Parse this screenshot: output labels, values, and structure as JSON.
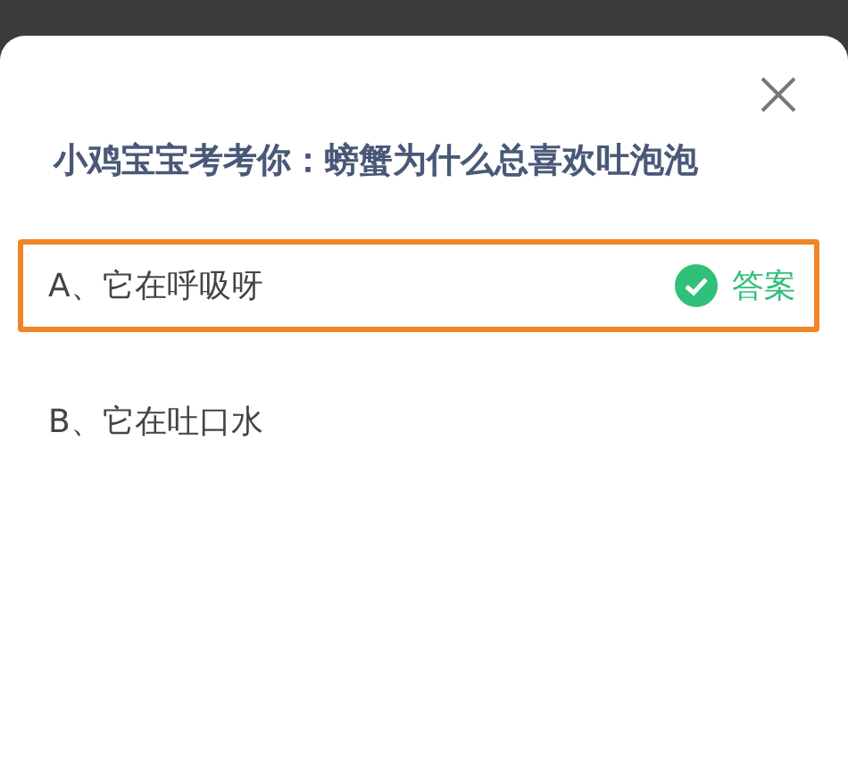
{
  "question": "小鸡宝宝考考你：螃蟹为什么总喜欢吐泡泡",
  "options": [
    {
      "label": "A、它在呼吸呀",
      "selected": true,
      "badge": "答案"
    },
    {
      "label": "B、它在吐口水",
      "selected": false
    }
  ]
}
